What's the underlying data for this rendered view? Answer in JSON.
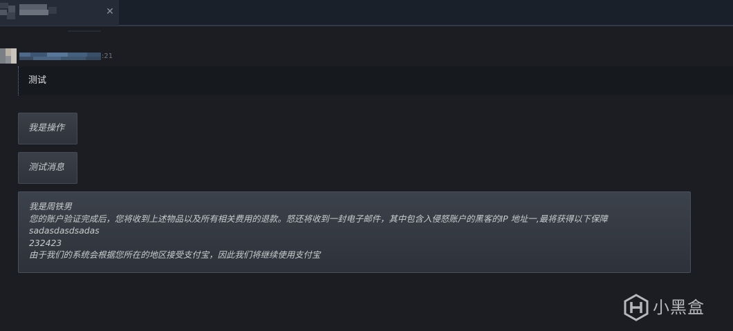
{
  "tab": {
    "close_glyph": "✕"
  },
  "message": {
    "time_suffix": ":21",
    "text": "测试"
  },
  "actions": [
    {
      "label": "我是操作"
    },
    {
      "label": "测试消息"
    }
  ],
  "info_box": {
    "lines": [
      "我是周铁男",
      "您的账户验证完成后，您将收到上述物品以及所有相关费用的退款。怒还将收到一封电子邮件，其中包含入侵怒账户的黑客的IP 地址一,最将获得以下保障",
      "sadasdasdsadas",
      "232423",
      "由于我们的系统会根据您所在的地区接受支付宝，因此我们将继续使用支付宝"
    ]
  },
  "watermark": {
    "text": "小黑盒",
    "icon": "heybox-logo-icon"
  },
  "colors": {
    "background": "#1c1d22",
    "topbar": "#1a2029",
    "tab": "#262c37",
    "message_bg": "#16191e",
    "button_bg": "#373c45",
    "info_bg": "#353a42"
  }
}
